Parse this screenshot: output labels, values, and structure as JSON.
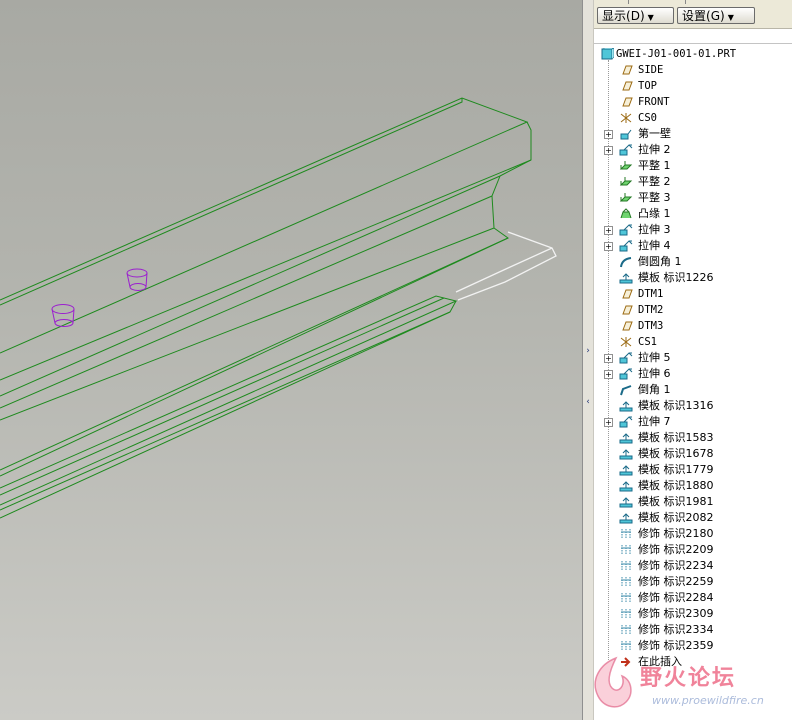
{
  "toolbar": {
    "display_label": "显示",
    "display_shortcut": "(D)",
    "settings_label": "设置",
    "settings_shortcut": "(G)"
  },
  "tree": {
    "root": "GWEI-J01-001-01.PRT",
    "items": [
      {
        "label": "SIDE",
        "icon": "datum-plane-icon",
        "expandable": false
      },
      {
        "label": "TOP",
        "icon": "datum-plane-icon",
        "expandable": false
      },
      {
        "label": "FRONT",
        "icon": "datum-plane-icon",
        "expandable": false
      },
      {
        "label": "CS0",
        "icon": "coordinate-system-icon",
        "expandable": false
      },
      {
        "label": "第一壁",
        "icon": "sheetmetal-wall-icon",
        "expandable": true
      },
      {
        "label": "拉伸 2",
        "icon": "extrude-icon",
        "expandable": true
      },
      {
        "label": "平整 1",
        "icon": "flat-wall-icon",
        "expandable": false
      },
      {
        "label": "平整 2",
        "icon": "flat-wall-icon",
        "expandable": false
      },
      {
        "label": "平整 3",
        "icon": "flat-wall-icon",
        "expandable": false
      },
      {
        "label": "凸缘 1",
        "icon": "flange-icon",
        "expandable": false
      },
      {
        "label": "拉伸 3",
        "icon": "extrude-icon",
        "expandable": true
      },
      {
        "label": "拉伸 4",
        "icon": "extrude-icon",
        "expandable": true
      },
      {
        "label": "倒圆角 1",
        "icon": "round-icon",
        "expandable": false
      },
      {
        "label": "模板 标识1226",
        "icon": "form-icon",
        "expandable": false
      },
      {
        "label": "DTM1",
        "icon": "datum-plane-icon",
        "expandable": false
      },
      {
        "label": "DTM2",
        "icon": "datum-plane-icon",
        "expandable": false
      },
      {
        "label": "DTM3",
        "icon": "datum-plane-icon",
        "expandable": false
      },
      {
        "label": "CS1",
        "icon": "coordinate-system-icon",
        "expandable": false
      },
      {
        "label": "拉伸 5",
        "icon": "extrude-icon",
        "expandable": true
      },
      {
        "label": "拉伸 6",
        "icon": "extrude-icon",
        "expandable": true
      },
      {
        "label": "倒角 1",
        "icon": "chamfer-icon",
        "expandable": false
      },
      {
        "label": "模板 标识1316",
        "icon": "form-icon",
        "expandable": false
      },
      {
        "label": "拉伸 7",
        "icon": "extrude-icon",
        "expandable": true
      },
      {
        "label": "模板 标识1583",
        "icon": "form-icon",
        "expandable": false
      },
      {
        "label": "模板 标识1678",
        "icon": "form-icon",
        "expandable": false
      },
      {
        "label": "模板 标识1779",
        "icon": "form-icon",
        "expandable": false
      },
      {
        "label": "模板 标识1880",
        "icon": "form-icon",
        "expandable": false
      },
      {
        "label": "模板 标识1981",
        "icon": "form-icon",
        "expandable": false
      },
      {
        "label": "模板 标识2082",
        "icon": "form-icon",
        "expandable": false
      },
      {
        "label": "修饰 标识2180",
        "icon": "cosmetic-icon",
        "expandable": false
      },
      {
        "label": "修饰 标识2209",
        "icon": "cosmetic-icon",
        "expandable": false
      },
      {
        "label": "修饰 标识2234",
        "icon": "cosmetic-icon",
        "expandable": false
      },
      {
        "label": "修饰 标识2259",
        "icon": "cosmetic-icon",
        "expandable": false
      },
      {
        "label": "修饰 标识2284",
        "icon": "cosmetic-icon",
        "expandable": false
      },
      {
        "label": "修饰 标识2309",
        "icon": "cosmetic-icon",
        "expandable": false
      },
      {
        "label": "修饰 标识2334",
        "icon": "cosmetic-icon",
        "expandable": false
      },
      {
        "label": "修饰 标识2359",
        "icon": "cosmetic-icon",
        "expandable": false
      },
      {
        "label": "在此插入",
        "icon": "insert-here-icon",
        "expandable": false
      }
    ]
  },
  "watermark": {
    "text": "野火论坛",
    "url": "www.proewildfire.cn"
  },
  "colors": {
    "model_edge": "#1e8a1e",
    "hole_edge": "#9b1fcf",
    "highlight_edge": "#f2f2f2",
    "viewport_bg": "#b3b4ae"
  }
}
